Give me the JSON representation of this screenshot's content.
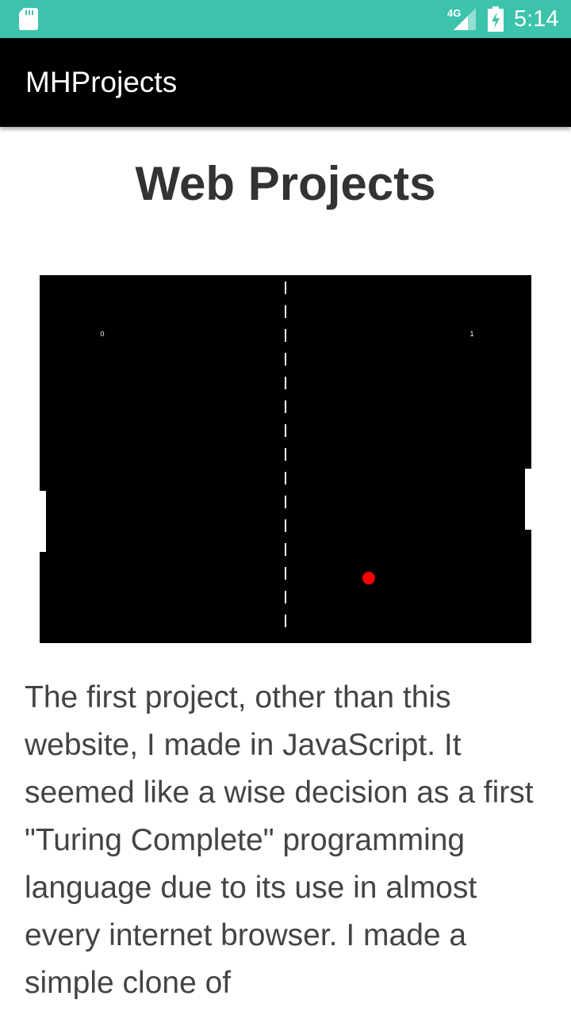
{
  "status_bar": {
    "time": "5:14",
    "network": "4G",
    "icons": [
      "sd-card-icon",
      "signal-icon",
      "battery-charging-icon"
    ],
    "background": "#3dc3ac"
  },
  "app_bar": {
    "title": "MHProjects",
    "background": "#000000"
  },
  "page": {
    "heading": "Web Projects",
    "description": "The first project, other than this website, I made in JavaScript. It seemed like a wise decision as a first \"Turing Complete\" programming language due to its use in almost every internet browser. I made a simple clone of"
  },
  "game": {
    "score_left": "0",
    "score_right": "1",
    "ball_color": "#ff0000",
    "background": "#000000"
  }
}
